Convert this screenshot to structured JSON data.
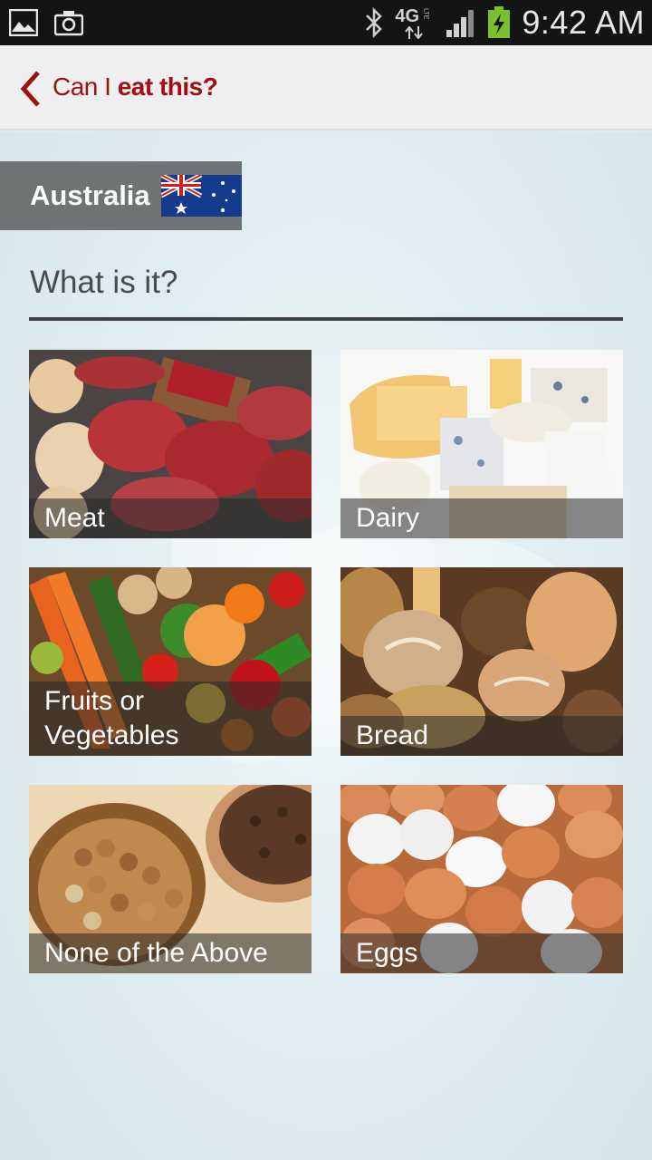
{
  "status_bar": {
    "time": "9:42 AM",
    "network": "4G",
    "network_sub": "LTE",
    "icons": [
      "image-icon",
      "camera-icon",
      "bluetooth-icon",
      "signal-icon",
      "battery-charging-icon"
    ]
  },
  "header": {
    "title_light": "Can I ",
    "title_bold": "eat this?",
    "back_icon": "chevron-left-icon",
    "accent": "#a01010"
  },
  "country": {
    "name": "Australia",
    "flag": "australia-flag-icon"
  },
  "question": "What is it?",
  "categories": [
    {
      "label": "Meat"
    },
    {
      "label": "Dairy"
    },
    {
      "label": "Fruits or Vegetables"
    },
    {
      "label": "Bread"
    },
    {
      "label": "None of the Above"
    },
    {
      "label": "Eggs"
    }
  ]
}
